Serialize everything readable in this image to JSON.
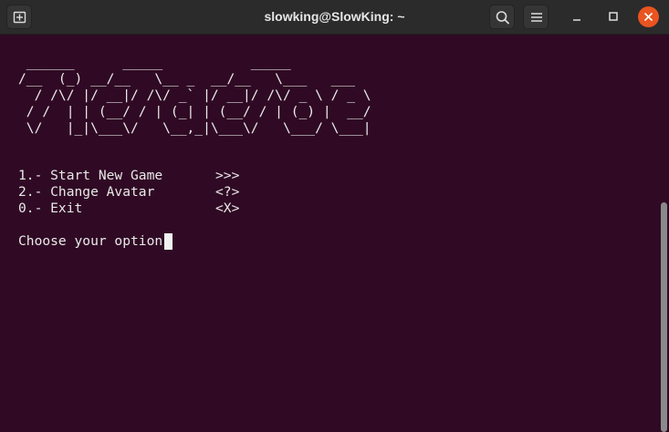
{
  "window": {
    "title": "slowking@SlowKing: ~"
  },
  "terminal": {
    "ascii_art": [
      " ______      _____           _____",
      "/__  (_) __/__   \\__ _  __/__   \\___   ___",
      "  / /\\/ |/ __|/ /\\/ _` |/ __|/ /\\/ _ \\ / _ \\",
      " / /  | | (__/ / | (_| | (__/ / | (_) |  __/",
      " \\/   |_|\\___\\/   \\__,_|\\___\\/   \\___/ \\___|"
    ],
    "menu": [
      {
        "label": "1.- Start New Game",
        "symbol": ">>>"
      },
      {
        "label": "2.- Change Avatar",
        "symbol": "<?>"
      },
      {
        "label": "0.- Exit",
        "symbol": "<X>"
      }
    ],
    "prompt": "Choose your option: "
  },
  "colors": {
    "background": "#300a24",
    "titlebar": "#2b2b2b",
    "close_button": "#e95420",
    "text": "#e9e9e9"
  },
  "icons": {
    "new_tab": "new-tab-icon",
    "search": "search-icon",
    "menu": "hamburger-menu-icon",
    "minimize": "minimize-icon",
    "maximize": "maximize-icon",
    "close": "close-icon"
  }
}
